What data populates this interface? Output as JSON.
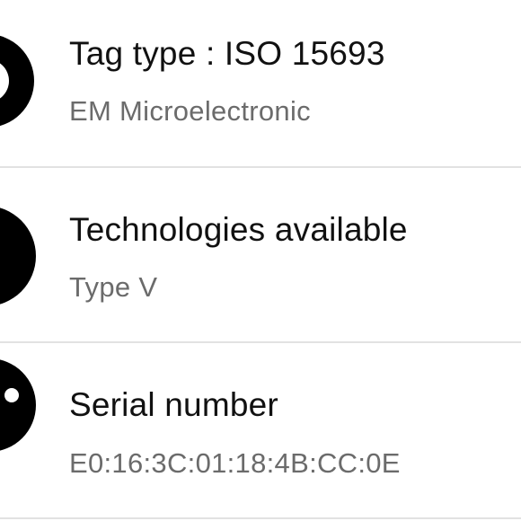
{
  "rows": [
    {
      "icon": "tag-type-icon",
      "title": "Tag type : ISO 15693",
      "subtitle": "EM Microelectronic"
    },
    {
      "icon": "technologies-icon",
      "title": "Technologies available",
      "subtitle": "Type V"
    },
    {
      "icon": "serial-number-icon",
      "title": "Serial number",
      "subtitle": "E0:16:3C:01:18:4B:CC:0E"
    }
  ]
}
